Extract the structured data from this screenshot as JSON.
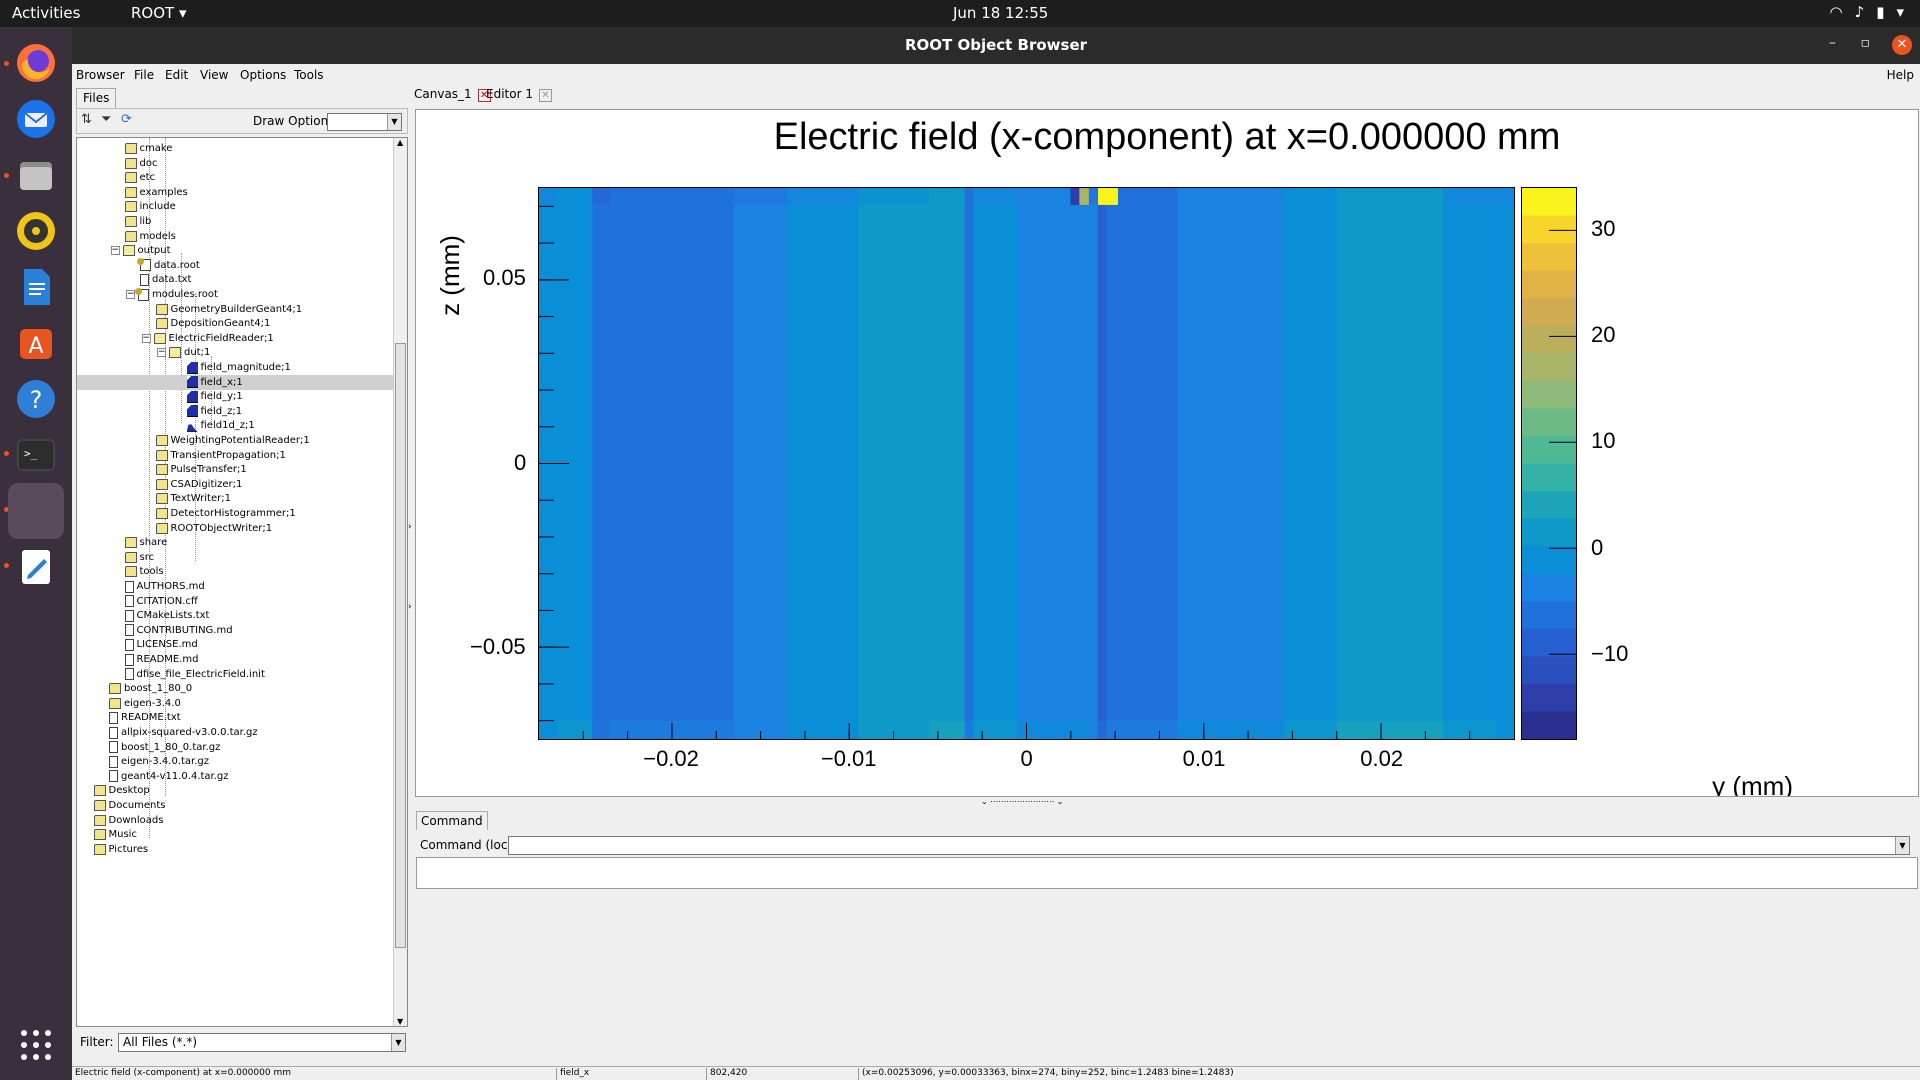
{
  "topbar": {
    "activities": "Activities",
    "app_menu": "ROOT ▾",
    "clock": "Jun 18  12:55"
  },
  "dock": {
    "items": [
      "firefox-icon",
      "thunderbird-icon",
      "files-icon",
      "rhythmbox-icon",
      "writer-icon",
      "software-icon",
      "help-icon",
      "terminal-icon",
      "root-app-icon",
      "text-editor-icon",
      "app-grid-icon"
    ]
  },
  "window": {
    "title": "ROOT Object Browser"
  },
  "menu": {
    "browser": "Browser",
    "file": "File",
    "edit": "Edit",
    "view": "View",
    "options": "Options",
    "tools": "Tools",
    "help": "Help"
  },
  "left": {
    "files_tab": "Files",
    "draw_option_label": "Draw Option:",
    "draw_option_value": "",
    "filter_label": "Filter:",
    "filter_value": "All Files (*.*)"
  },
  "tree": [
    {
      "label": "cmake",
      "type": "folder",
      "depth": 5
    },
    {
      "label": "doc",
      "type": "folder",
      "depth": 5
    },
    {
      "label": "etc",
      "type": "folder",
      "depth": 5
    },
    {
      "label": "examples",
      "type": "folder",
      "depth": 5
    },
    {
      "label": "include",
      "type": "folder",
      "depth": 5
    },
    {
      "label": "lib",
      "type": "folder",
      "depth": 5
    },
    {
      "label": "models",
      "type": "folder",
      "depth": 5
    },
    {
      "label": "output",
      "type": "folder-open",
      "depth": 5,
      "expander": "−"
    },
    {
      "label": "data.root",
      "type": "rootfile",
      "depth": 6
    },
    {
      "label": "data.txt",
      "type": "file",
      "depth": 6
    },
    {
      "label": "modules.root",
      "type": "rootfile",
      "depth": 6,
      "expander": "−"
    },
    {
      "label": "GeometryBuilderGeant4;1",
      "type": "folder",
      "depth": 7
    },
    {
      "label": "DepositionGeant4;1",
      "type": "folder",
      "depth": 7
    },
    {
      "label": "ElectricFieldReader;1",
      "type": "folder-open",
      "depth": 7,
      "expander": "−"
    },
    {
      "label": "dut;1",
      "type": "folder-open",
      "depth": 8,
      "expander": "−"
    },
    {
      "label": "field_magnitude;1",
      "type": "hist",
      "depth": 9
    },
    {
      "label": "field_x;1",
      "type": "hist",
      "depth": 9,
      "selected": true
    },
    {
      "label": "field_y;1",
      "type": "hist",
      "depth": 9
    },
    {
      "label": "field_z;1",
      "type": "hist",
      "depth": 9
    },
    {
      "label": "field1d_z;1",
      "type": "hist1d",
      "depth": 9
    },
    {
      "label": "WeightingPotentialReader;1",
      "type": "folder",
      "depth": 7
    },
    {
      "label": "TransientPropagation;1",
      "type": "folder",
      "depth": 7
    },
    {
      "label": "PulseTransfer;1",
      "type": "folder",
      "depth": 7
    },
    {
      "label": "CSADigitizer;1",
      "type": "folder",
      "depth": 7
    },
    {
      "label": "TextWriter;1",
      "type": "folder",
      "depth": 7
    },
    {
      "label": "DetectorHistogrammer;1",
      "type": "folder",
      "depth": 7
    },
    {
      "label": "ROOTObjectWriter;1",
      "type": "folder",
      "depth": 7
    },
    {
      "label": "share",
      "type": "folder",
      "depth": 5
    },
    {
      "label": "src",
      "type": "folder",
      "depth": 5
    },
    {
      "label": "tools",
      "type": "folder",
      "depth": 5
    },
    {
      "label": "AUTHORS.md",
      "type": "file",
      "depth": 5
    },
    {
      "label": "CITATION.cff",
      "type": "file",
      "depth": 5
    },
    {
      "label": "CMakeLists.txt",
      "type": "file",
      "depth": 5
    },
    {
      "label": "CONTRIBUTING.md",
      "type": "file",
      "depth": 5
    },
    {
      "label": "LICENSE.md",
      "type": "file",
      "depth": 5
    },
    {
      "label": "README.md",
      "type": "file",
      "depth": 5
    },
    {
      "label": "dfise_file_ElectricField.init",
      "type": "file",
      "depth": 5
    },
    {
      "label": "boost_1_80_0",
      "type": "folder",
      "depth": 4
    },
    {
      "label": "eigen-3.4.0",
      "type": "folder",
      "depth": 4
    },
    {
      "label": "README.txt",
      "type": "file",
      "depth": 4
    },
    {
      "label": "allpix-squared-v3.0.0.tar.gz",
      "type": "file",
      "depth": 4
    },
    {
      "label": "boost_1_80_0.tar.gz",
      "type": "file",
      "depth": 4
    },
    {
      "label": "eigen-3.4.0.tar.gz",
      "type": "file",
      "depth": 4
    },
    {
      "label": "geant4-v11.0.4.tar.gz",
      "type": "file",
      "depth": 4
    },
    {
      "label": "Desktop",
      "type": "folder",
      "depth": 3
    },
    {
      "label": "Documents",
      "type": "folder",
      "depth": 3
    },
    {
      "label": "Downloads",
      "type": "folder",
      "depth": 3
    },
    {
      "label": "Music",
      "type": "folder",
      "depth": 3
    },
    {
      "label": "Pictures",
      "type": "folder",
      "depth": 3
    }
  ],
  "tabs": {
    "canvas": "Canvas_1",
    "editor": "Editor 1"
  },
  "chart_data": {
    "type": "heatmap",
    "title": "Electric field (x-component) at x=0.000000 mm",
    "xlabel": "y (mm)",
    "ylabel": "z (mm)",
    "xlim": [
      -0.0275,
      0.0275
    ],
    "ylim": [
      -0.075,
      0.075
    ],
    "x_ticks": [
      "−0.02",
      "−0.01",
      "0",
      "0.01",
      "0.02"
    ],
    "x_tick_values": [
      -0.02,
      -0.01,
      0,
      0.01,
      0.02
    ],
    "y_ticks": [
      "0.05",
      "0",
      "−0.05"
    ],
    "y_tick_values": [
      0.05,
      0,
      -0.05
    ],
    "z_ticks": [
      "30",
      "20",
      "10",
      "0",
      "−10"
    ],
    "z_tick_values": [
      30,
      20,
      10,
      0,
      -10
    ],
    "zlim": [
      -18,
      34
    ],
    "column_edges": [
      -0.0275,
      -0.0265,
      -0.0245,
      -0.0235,
      -0.0205,
      -0.0165,
      -0.0135,
      -0.0095,
      -0.0055,
      -0.0035,
      -0.003,
      -0.0005,
      0.0035,
      0.004,
      0.0045,
      0.0065,
      0.0085,
      0.0145,
      0.0175,
      0.0235,
      0.0265,
      0.0275
    ],
    "column_values": [
      -2,
      0,
      -7,
      -6,
      -5,
      -4,
      -2,
      1,
      2,
      -5,
      -1,
      -3,
      -4,
      -9,
      -6,
      -5,
      -3,
      0,
      2,
      -1,
      -2
    ],
    "hot_cells": [
      {
        "y": 0.00275,
        "value": -15
      },
      {
        "y": 0.00325,
        "value": 18
      },
      {
        "y": 0.0043,
        "value": 34
      }
    ],
    "palette": [
      "#fbf31c",
      "#f7d52b",
      "#efc13a",
      "#e1b347",
      "#d0ab52",
      "#bcaf5c",
      "#a9b46b",
      "#8dba78",
      "#6cba84",
      "#4fb894",
      "#34b2a5",
      "#1ea5b9",
      "#0f99c8",
      "#0a8ed6",
      "#1a82e0",
      "#2171dd",
      "#2760d0",
      "#2a50c0",
      "#2c3fa8",
      "#2b2f8f"
    ]
  },
  "command": {
    "tab": "Command",
    "label": "Command (local):",
    "value": ""
  },
  "status": {
    "object": "Electric field (x-component) at x=0.000000 mm",
    "name": "field_x",
    "pixel": "802,420",
    "info": "(x=0.00253096, y=0.00033363, binx=274, biny=252, binc=1.2483 bine=1.2483)"
  }
}
